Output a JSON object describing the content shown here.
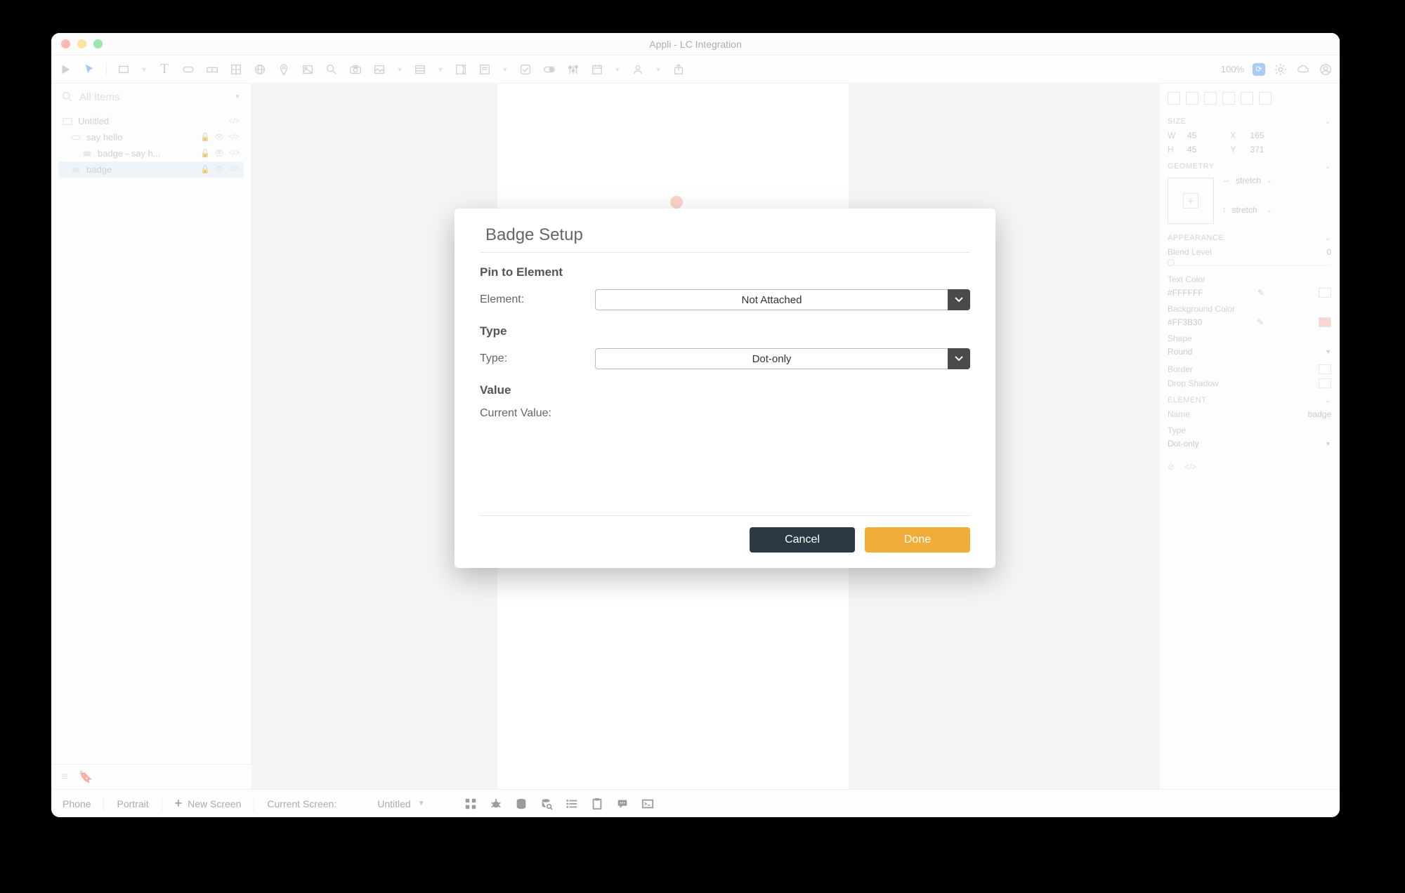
{
  "window": {
    "title": "Appli - LC Integration"
  },
  "toolbar": {
    "zoom": "100%"
  },
  "search": {
    "placeholder": "All Items"
  },
  "tree": {
    "card": "Untitled",
    "items": [
      {
        "label": "say hello"
      },
      {
        "label": "badge - say h..."
      },
      {
        "label": "badge"
      }
    ]
  },
  "inspector": {
    "size_h": "SIZE",
    "w_l": "W",
    "w_v": "45",
    "x_l": "X",
    "x_v": "165",
    "h_l": "H",
    "h_v": "45",
    "y_l": "Y",
    "y_v": "371",
    "geom_h": "GEOMETRY",
    "stretch1": "stretch",
    "stretch2": "stretch",
    "appear_h": "APPEARANCE",
    "blend_l": "Blend Level",
    "blend_v": "0",
    "tcolor_l": "Text Color",
    "tcolor_v": "#FFFFFF",
    "bcolor_l": "Background Color",
    "bcolor_v": "#FF3B30",
    "shape_l": "Shape",
    "shape_v": "Round",
    "border_l": "Border",
    "shadow_l": "Drop Shadow",
    "elem_h": "ELEMENT",
    "name_l": "Name",
    "name_v": "badge",
    "type_l": "Type",
    "type_v": "Dot-only"
  },
  "bottom": {
    "device": "Phone",
    "orient": "Portrait",
    "newscreen": "New Screen",
    "cur_l": "Current Screen:",
    "cur_v": "Untitled"
  },
  "modal": {
    "title": "Badge Setup",
    "pin_h": "Pin to Element",
    "elem_l": "Element:",
    "elem_v": "Not Attached",
    "type_h": "Type",
    "type_l": "Type:",
    "type_v": "Dot-only",
    "value_h": "Value",
    "curval_l": "Current Value:",
    "cancel": "Cancel",
    "done": "Done"
  },
  "colors": {
    "accent": "#f0ad3a",
    "badge_red": "#f6a08e",
    "bg_swatch": "#f5a49a"
  }
}
